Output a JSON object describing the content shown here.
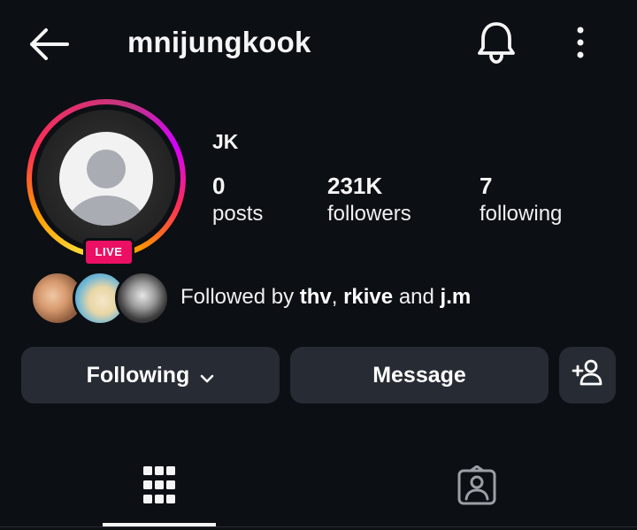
{
  "header": {
    "username": "mnijungkook",
    "icons": {
      "back": "arrow-left-icon",
      "notifications": "bell-icon",
      "more": "more-vertical-icon"
    }
  },
  "profile": {
    "display_name": "JK",
    "live_label": "LIVE",
    "stats": {
      "posts": {
        "value": "0",
        "label": "posts"
      },
      "followers": {
        "value": "231K",
        "label": "followers"
      },
      "following": {
        "value": "7",
        "label": "following"
      }
    }
  },
  "followed_by": {
    "prefix": "Followed by",
    "users": [
      "thv",
      "rkive",
      "j.m"
    ],
    "separator": ",",
    "conjunction": "and"
  },
  "actions": {
    "following_label": "Following",
    "message_label": "Message",
    "add_user_icon": "add-user-icon"
  },
  "tabs": {
    "grid_icon": "grid-icon",
    "tagged_icon": "tagged-photos-icon",
    "active": "grid"
  },
  "colors": {
    "background": "#0c0f14",
    "button": "#272b33",
    "live_badge": "#ec1064",
    "text": "#f5f5f5"
  }
}
